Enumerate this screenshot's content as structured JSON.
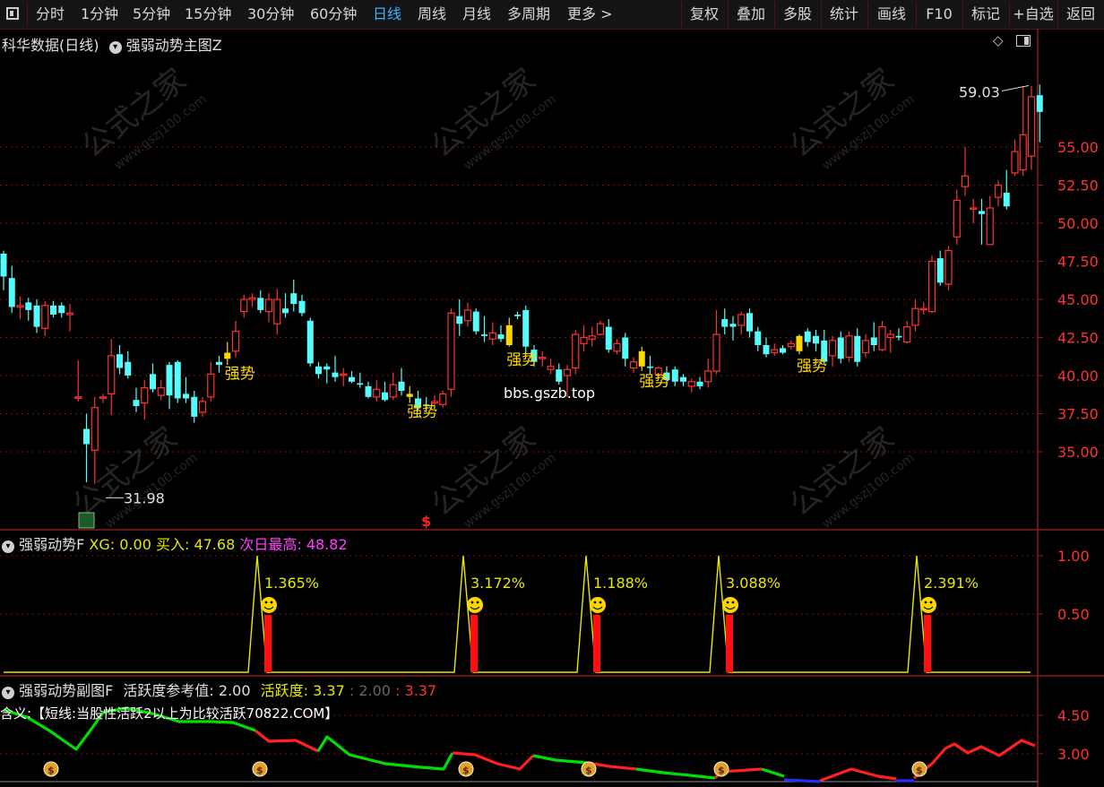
{
  "toolbar": {
    "periods": [
      "分时",
      "1分钟",
      "5分钟",
      "15分钟",
      "30分钟",
      "60分钟",
      "日线",
      "周线",
      "月线",
      "多周期",
      "更多 >"
    ],
    "active_period": "日线",
    "buttons": [
      "复权",
      "叠加",
      "多股",
      "统计",
      "画线",
      "F10",
      "标记",
      "+自选",
      "返回"
    ]
  },
  "main_pane": {
    "stock_name": "科华数据(日线)",
    "indicator_name": "强弱动势主图Z",
    "high_label": "59.03",
    "low_label": "31.98",
    "signal_label": "强势",
    "dollar_mark": "$",
    "watermark_url": "bbs.gszb.top",
    "watermark_text": "公式之家",
    "watermark_site": "www.gszj100.com",
    "y_ticks": [
      "55.00",
      "52.50",
      "50.00",
      "47.50",
      "45.00",
      "42.50",
      "40.00",
      "37.50",
      "35.00"
    ]
  },
  "sub_pane1": {
    "name": "强弱动势F",
    "items": [
      {
        "label": "XG:",
        "value": "0.00",
        "color": "#e8e800"
      },
      {
        "label": "买入:",
        "value": "47.68",
        "color": "#e8e800"
      },
      {
        "label": "次日最高:",
        "value": "48.82",
        "color": "#ff40ff"
      }
    ],
    "pct_labels": [
      "1.365%",
      "3.172%",
      "1.188%",
      "3.088%",
      "2.391%"
    ],
    "y_ticks": [
      "1.00",
      "0.50"
    ]
  },
  "sub_pane2": {
    "name": "强弱动势副图F",
    "ref_label": "活跃度参考值:",
    "ref_value": "2.00",
    "act_label": "活跃度:",
    "act_value": "3.37",
    "act_v2": "2.00",
    "act_v3": "3.37",
    "legend_text": "含义:【短线:当股性活跃2以上为比较活跃70822.COM】",
    "y_ticks": [
      "4.50",
      "3.00"
    ]
  },
  "colors": {
    "up": "#ff3232",
    "down": "#54fcfc",
    "signal": "#ffd700",
    "axis_border": "#8b1a1a",
    "grid": "#7a1010",
    "text_yellow": "#e8e800",
    "green_line": "#00e000",
    "red_line": "#ff2020",
    "blue_line": "#2030ff"
  },
  "chart_data": {
    "type": "candlestick",
    "y_range": [
      31.0,
      61.0
    ],
    "high_mark": 59.03,
    "low_mark": 31.98,
    "candles": [
      [
        48.0,
        46.5,
        48.2,
        45.6
      ],
      [
        46.4,
        44.5,
        47.2,
        44.1
      ],
      [
        44.5,
        44.6,
        45.2,
        43.7
      ],
      [
        44.8,
        44.3,
        45.1,
        43.6
      ],
      [
        44.6,
        43.2,
        45.0,
        42.8
      ],
      [
        43.1,
        44.6,
        44.9,
        42.6
      ],
      [
        44.6,
        44.0,
        44.9,
        43.8
      ],
      [
        44.6,
        44.1,
        44.8,
        43.8
      ],
      [
        44.0,
        44.1,
        44.7,
        42.9
      ],
      [
        38.6,
        38.6,
        41.0,
        38.3
      ],
      [
        36.5,
        35.5,
        37.5,
        33.0
      ],
      [
        35.1,
        37.9,
        38.6,
        32.9
      ],
      [
        38.6,
        38.6,
        38.8,
        38.2
      ],
      [
        38.8,
        41.3,
        42.4,
        37.4
      ],
      [
        41.4,
        40.5,
        42.0,
        40.1
      ],
      [
        40.9,
        40.0,
        41.6,
        39.8
      ],
      [
        38.4,
        38.0,
        39.2,
        37.6
      ],
      [
        38.2,
        39.2,
        39.7,
        37.1
      ],
      [
        40.1,
        39.1,
        40.8,
        38.9
      ],
      [
        38.7,
        39.2,
        39.7,
        38.4
      ],
      [
        40.7,
        38.7,
        40.9,
        37.8
      ],
      [
        40.9,
        38.5,
        41.0,
        38.2
      ],
      [
        38.8,
        38.5,
        39.9,
        38.2
      ],
      [
        38.6,
        37.3,
        39.0,
        36.9
      ],
      [
        37.6,
        38.3,
        38.6,
        37.3
      ],
      [
        38.6,
        40.1,
        40.9,
        38.3
      ],
      [
        40.9,
        40.7,
        41.3,
        40.2
      ],
      [
        41.1,
        41.5,
        42.2,
        40.7
      ],
      [
        41.6,
        42.9,
        43.6,
        41.2
      ],
      [
        44.2,
        45.0,
        45.3,
        43.8
      ],
      [
        45.0,
        45.1,
        45.4,
        44.5
      ],
      [
        45.1,
        44.3,
        45.6,
        44.1
      ],
      [
        44.2,
        45.0,
        45.4,
        43.5
      ],
      [
        43.4,
        45.0,
        45.7,
        42.7
      ],
      [
        44.4,
        44.1,
        45.4,
        43.8
      ],
      [
        45.4,
        44.7,
        46.3,
        44.2
      ],
      [
        44.9,
        44.1,
        45.3,
        43.9
      ],
      [
        43.6,
        40.8,
        43.8,
        40.6
      ],
      [
        40.6,
        40.1,
        40.9,
        39.8
      ],
      [
        40.6,
        40.4,
        40.8,
        39.5
      ],
      [
        40.2,
        39.9,
        41.3,
        39.6
      ],
      [
        40.1,
        40.1,
        40.5,
        39.3
      ],
      [
        39.9,
        39.6,
        40.3,
        39.5
      ],
      [
        39.5,
        39.4,
        40.2,
        39.2
      ],
      [
        39.3,
        38.6,
        39.6,
        38.5
      ],
      [
        38.6,
        39.1,
        39.7,
        38.3
      ],
      [
        38.9,
        38.4,
        39.6,
        38.3
      ],
      [
        38.6,
        39.4,
        40.2,
        38.4
      ],
      [
        39.6,
        39.0,
        40.5,
        38.7
      ],
      [
        38.6,
        38.8,
        39.3,
        38.2
      ],
      [
        38.5,
        37.9,
        39.0,
        37.7
      ],
      [
        38.1,
        38.0,
        38.6,
        37.6
      ],
      [
        38.2,
        38.3,
        38.7,
        37.9
      ],
      [
        38.1,
        38.8,
        39.0,
        37.9
      ],
      [
        39.1,
        44.1,
        44.4,
        38.6
      ],
      [
        43.9,
        43.4,
        45.0,
        42.6
      ],
      [
        43.6,
        44.3,
        44.8,
        43.2
      ],
      [
        44.2,
        42.9,
        44.4,
        42.7
      ],
      [
        42.7,
        42.6,
        43.9,
        42.2
      ],
      [
        42.4,
        42.8,
        43.5,
        42.0
      ],
      [
        42.7,
        42.4,
        43.3,
        42.2
      ],
      [
        42.0,
        43.3,
        43.8,
        41.9
      ],
      [
        44.0,
        43.9,
        44.2,
        43.7
      ],
      [
        44.3,
        41.9,
        44.6,
        41.4
      ],
      [
        41.7,
        40.9,
        42.0,
        40.6
      ],
      [
        41.2,
        41.2,
        41.6,
        40.6
      ],
      [
        40.4,
        40.6,
        41.1,
        40.1
      ],
      [
        40.4,
        39.6,
        40.8,
        39.4
      ],
      [
        40.0,
        40.4,
        40.7,
        38.6
      ],
      [
        40.5,
        42.7,
        43.0,
        40.1
      ],
      [
        42.1,
        42.5,
        43.3,
        41.6
      ],
      [
        42.4,
        42.6,
        43.2,
        41.9
      ],
      [
        42.7,
        43.4,
        43.6,
        42.6
      ],
      [
        43.2,
        41.7,
        43.7,
        41.5
      ],
      [
        41.6,
        42.1,
        42.4,
        41.4
      ],
      [
        42.5,
        41.1,
        42.8,
        40.6
      ],
      [
        40.5,
        40.9,
        41.2,
        40.2
      ],
      [
        41.6,
        40.6,
        41.9,
        40.3
      ],
      [
        40.6,
        40.5,
        41.3,
        40.1
      ],
      [
        40.1,
        40.5,
        40.6,
        39.7
      ],
      [
        40.2,
        39.7,
        40.6,
        39.3
      ],
      [
        40.4,
        39.6,
        40.6,
        39.3
      ],
      [
        39.9,
        39.6,
        40.1,
        39.3
      ],
      [
        39.3,
        39.6,
        39.8,
        38.9
      ],
      [
        39.6,
        39.3,
        39.9,
        39.1
      ],
      [
        39.6,
        40.3,
        41.1,
        39.2
      ],
      [
        40.3,
        42.7,
        44.3,
        40.1
      ],
      [
        43.7,
        43.2,
        44.4,
        42.7
      ],
      [
        43.4,
        43.2,
        43.9,
        42.3
      ],
      [
        43.3,
        44.0,
        44.2,
        42.7
      ],
      [
        44.1,
        42.9,
        44.4,
        42.5
      ],
      [
        42.9,
        42.0,
        43.2,
        41.6
      ],
      [
        42.0,
        41.4,
        42.5,
        41.2
      ],
      [
        41.5,
        41.7,
        42.1,
        41.3
      ],
      [
        41.8,
        41.5,
        42.0,
        41.4
      ],
      [
        41.9,
        42.1,
        42.3,
        41.7
      ],
      [
        42.6,
        41.6,
        42.7,
        41.4
      ],
      [
        42.9,
        42.2,
        43.1,
        41.9
      ],
      [
        42.6,
        42.1,
        43.0,
        41.6
      ],
      [
        42.3,
        40.9,
        43.0,
        40.7
      ],
      [
        41.3,
        42.3,
        42.6,
        40.6
      ],
      [
        42.5,
        41.1,
        42.9,
        40.8
      ],
      [
        41.2,
        42.6,
        42.9,
        40.9
      ],
      [
        42.6,
        40.9,
        43.1,
        40.6
      ],
      [
        41.5,
        42.3,
        42.7,
        41.2
      ],
      [
        42.5,
        42.0,
        43.5,
        41.6
      ],
      [
        41.7,
        43.2,
        43.6,
        41.6
      ],
      [
        42.5,
        42.7,
        43.0,
        41.5
      ],
      [
        42.6,
        42.5,
        43.1,
        42.3
      ],
      [
        42.2,
        43.2,
        43.6,
        42.1
      ],
      [
        43.3,
        44.4,
        45.0,
        42.9
      ],
      [
        44.4,
        44.4,
        44.8,
        44.0
      ],
      [
        44.2,
        47.5,
        47.9,
        44.1
      ],
      [
        47.7,
        46.1,
        48.2,
        45.9
      ],
      [
        46.0,
        48.2,
        48.5,
        45.6
      ],
      [
        49.1,
        51.5,
        52.2,
        48.6
      ],
      [
        52.4,
        53.1,
        55.0,
        51.8
      ],
      [
        51.0,
        51.0,
        51.6,
        50.0
      ],
      [
        50.8,
        50.6,
        51.6,
        48.6
      ],
      [
        48.6,
        51.0,
        51.8,
        48.6
      ],
      [
        51.7,
        52.5,
        52.8,
        51.1
      ],
      [
        52.0,
        51.1,
        53.5,
        50.9
      ],
      [
        53.3,
        54.7,
        55.5,
        53.1
      ],
      [
        53.5,
        55.8,
        59.0,
        53.1
      ],
      [
        54.4,
        58.3,
        59.0,
        53.5
      ],
      [
        58.4,
        57.3,
        59.1,
        55.3
      ]
    ],
    "signal_indices": [
      27,
      49,
      61,
      77,
      96
    ]
  }
}
